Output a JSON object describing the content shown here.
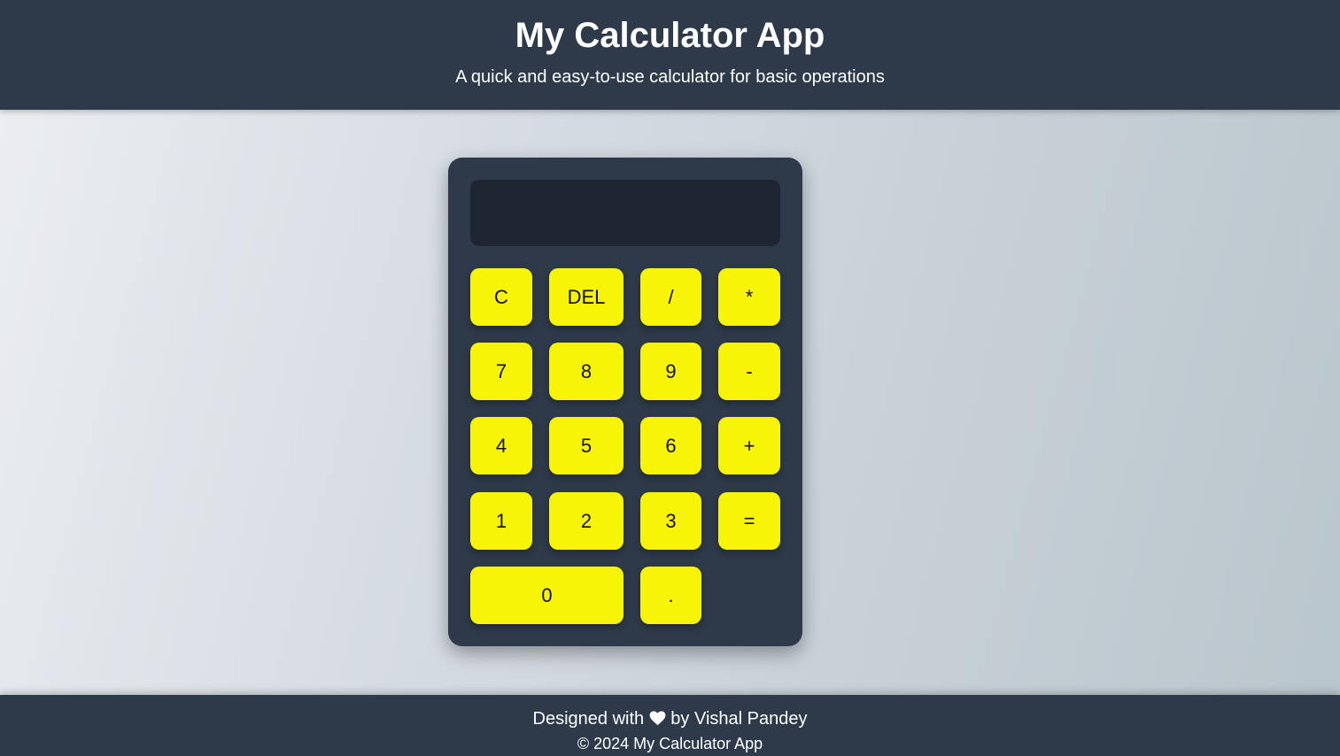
{
  "header": {
    "title": "My Calculator App",
    "subtitle": "A quick and easy-to-use calculator for basic operations"
  },
  "calculator": {
    "display_value": "",
    "keys": {
      "clear": "C",
      "delete": "DEL",
      "divide": "/",
      "multiply": "*",
      "seven": "7",
      "eight": "8",
      "nine": "9",
      "subtract": "-",
      "four": "4",
      "five": "5",
      "six": "6",
      "add": "+",
      "one": "1",
      "two": "2",
      "three": "3",
      "equals": "=",
      "zero": "0",
      "decimal": "."
    }
  },
  "footer": {
    "designed_prefix": "Designed with",
    "heart_icon": "heart-icon",
    "designed_suffix": "by Vishal Pandey",
    "copyright": "© 2024 My Calculator App"
  },
  "colors": {
    "header_bg": "#2e3a4a",
    "display_bg": "#1f2632",
    "key_bg": "#f8f408"
  }
}
